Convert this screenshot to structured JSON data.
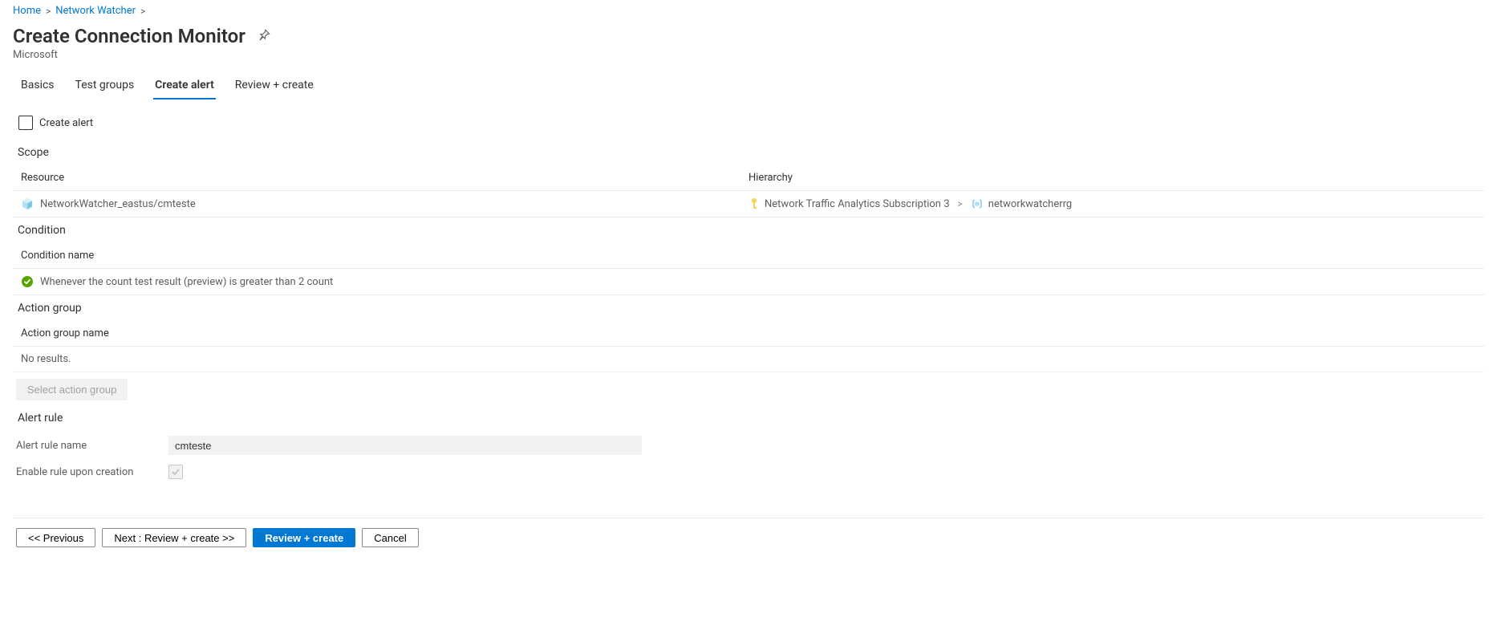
{
  "breadcrumb": {
    "home": "Home",
    "network_watcher": "Network Watcher"
  },
  "header": {
    "title": "Create Connection Monitor",
    "subtitle": "Microsoft"
  },
  "tabs": {
    "basics": "Basics",
    "test_groups": "Test groups",
    "create_alert": "Create alert",
    "review_create": "Review + create",
    "selected": "create_alert"
  },
  "create_alert_checkbox": {
    "label": "Create alert",
    "checked": false
  },
  "scope": {
    "label": "Scope",
    "columns": {
      "resource": "Resource",
      "hierarchy": "Hierarchy"
    },
    "row": {
      "resource": "NetworkWatcher_eastus/cmteste",
      "hierarchy_subscription": "Network Traffic Analytics Subscription 3",
      "hierarchy_rg": "networkwatcherrg"
    }
  },
  "condition": {
    "label": "Condition",
    "column": "Condition name",
    "row_text": "Whenever the count test result (preview) is greater than 2 count"
  },
  "action_group": {
    "label": "Action group",
    "column": "Action group name",
    "empty_text": "No results.",
    "select_button": "Select action group"
  },
  "alert_rule": {
    "label": "Alert rule",
    "name_label": "Alert rule name",
    "name_value": "cmteste",
    "enable_label": "Enable rule upon creation",
    "enable_checked": true
  },
  "footer": {
    "previous": "<< Previous",
    "next": "Next : Review + create >>",
    "review": "Review + create",
    "cancel": "Cancel"
  }
}
